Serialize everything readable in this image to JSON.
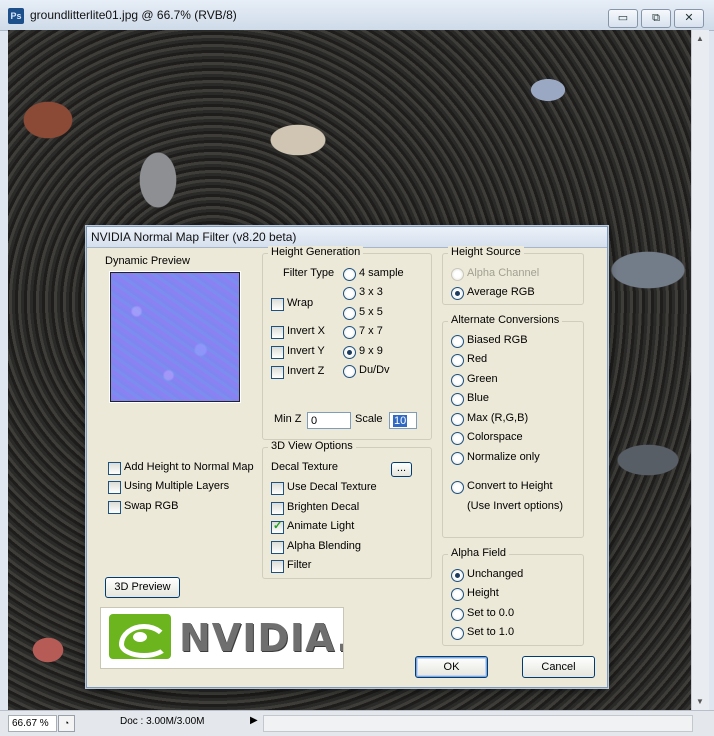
{
  "window": {
    "title": "groundlitterlite01.jpg @ 66.7% (RVB/8)",
    "app_icon": "Ps",
    "controls": {
      "minimize": "▭",
      "restore": "⧉",
      "close": "✕"
    }
  },
  "status": {
    "zoom": "66.67 %",
    "doc": "Doc : 3.00M/3.00M",
    "arrow": "▶"
  },
  "dialog": {
    "title": "NVIDIA Normal Map Filter (v8.20 beta)",
    "preview_label": "Dynamic Preview",
    "height_generation": {
      "legend": "Height Generation",
      "filter_type_label": "Filter Type",
      "filters": [
        "4 sample",
        "3 x 3",
        "5 x 5",
        "7 x 7",
        "9 x 9",
        "Du/Dv"
      ],
      "selected_filter": "9 x 9",
      "checks": [
        {
          "label": "Wrap",
          "checked": false
        },
        {
          "label": "Invert X",
          "checked": false
        },
        {
          "label": "Invert Y",
          "checked": false
        },
        {
          "label": "Invert Z",
          "checked": false
        }
      ],
      "minz_label": "Min Z",
      "minz_value": "0",
      "scale_label": "Scale",
      "scale_value": "10"
    },
    "left_options": [
      {
        "label": "Add Height to Normal Map",
        "checked": false
      },
      {
        "label": "Using Multiple Layers",
        "checked": false
      },
      {
        "label": "Swap RGB",
        "checked": false
      }
    ],
    "preview_3d_button": "3D Preview",
    "view_options": {
      "legend": "3D View Options",
      "decal_label": "Decal Texture",
      "browse_label": "...",
      "checks": [
        {
          "label": "Use Decal Texture",
          "checked": false
        },
        {
          "label": "Brighten Decal",
          "checked": false
        },
        {
          "label": "Animate Light",
          "checked": true
        },
        {
          "label": "Alpha Blending",
          "checked": false
        },
        {
          "label": "Filter",
          "checked": false
        }
      ]
    },
    "height_source": {
      "legend": "Height Source",
      "options": [
        {
          "label": "Alpha Channel",
          "selected": false,
          "disabled": true
        },
        {
          "label": "Average RGB",
          "selected": true,
          "disabled": false
        }
      ]
    },
    "alternate_conversions": {
      "legend": "Alternate Conversions",
      "options": [
        "Biased RGB",
        "Red",
        "Green",
        "Blue",
        "Max (R,G,B)",
        "Colorspace",
        "Normalize only"
      ],
      "convert_label": "Convert to Height",
      "convert_note": "(Use Invert options)"
    },
    "alpha_field": {
      "legend": "Alpha Field",
      "options": [
        "Unchanged",
        "Height",
        "Set to 0.0",
        "Set to 1.0"
      ],
      "selected": "Unchanged"
    },
    "ok_label": "OK",
    "cancel_label": "Cancel",
    "logo_text": "NVIDIA."
  }
}
